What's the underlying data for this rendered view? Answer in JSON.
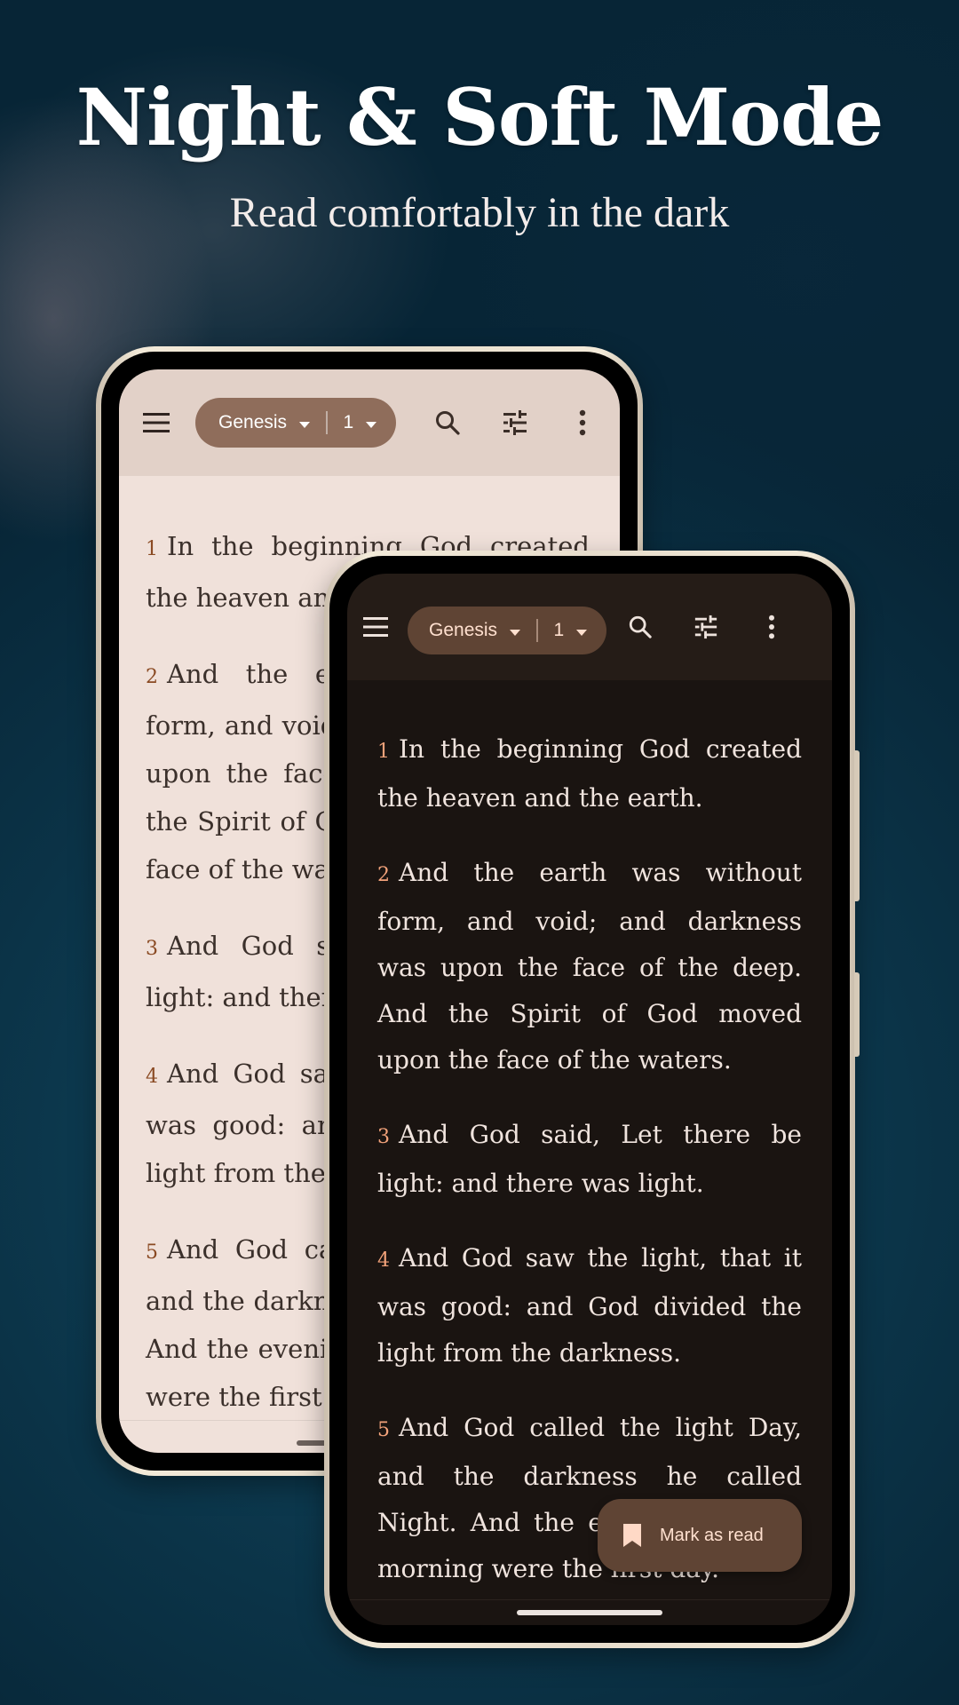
{
  "headline": "Night & Soft Mode",
  "subheadline": "Read comfortably in the dark",
  "colors": {
    "light_toolbar": "#e2d1c8",
    "light_page": "#f0e1da",
    "light_pill": "#8f6d5b",
    "light_verse_number": "#8a4a23",
    "dark_toolbar": "#251c17",
    "dark_page": "#1a1411",
    "dark_pill": "#5f4434",
    "dark_verse_number": "#f2a27a",
    "background": "#0b3a52"
  },
  "light_phone": {
    "theme": "soft",
    "toolbar": {
      "menu_icon": "hamburger-menu-icon",
      "book": "Genesis",
      "chapter": "1",
      "search_icon": "search-icon",
      "settings_icon": "tune-sliders-icon",
      "more_icon": "more-vertical-icon"
    },
    "verses": [
      {
        "num": "1",
        "text": "In the beginning God created the heaven and the earth."
      },
      {
        "num": "2",
        "text": "And the earth was without form, and void; and darkness was upon the face of the deep. And the Spirit of God moved upon the face of the waters."
      },
      {
        "num": "3",
        "text": "And God said, Let there be light: and there was light."
      },
      {
        "num": "4",
        "text": "And God saw the light, that it was good: and God divided the light from the darkness."
      },
      {
        "num": "5",
        "text": "And God called the light Day, and the darkness he called Night. And the evening and the morning were the first day."
      }
    ]
  },
  "dark_phone": {
    "theme": "night",
    "toolbar": {
      "menu_icon": "hamburger-menu-icon",
      "book": "Genesis",
      "chapter": "1",
      "search_icon": "search-icon",
      "settings_icon": "tune-sliders-icon",
      "more_icon": "more-vertical-icon"
    },
    "verses": [
      {
        "num": "1",
        "text": "In the beginning God created the heaven and the earth."
      },
      {
        "num": "2",
        "text": "And the earth was without form, and void; and darkness was upon the face of the deep. And the Spirit of God moved upon the face of the waters."
      },
      {
        "num": "3",
        "text": "And God said, Let there be light: and there was light."
      },
      {
        "num": "4",
        "text": "And God saw the light, that it was good: and God divided the light from the darkness."
      },
      {
        "num": "5",
        "text": "And God called the light Day, and the darkness he called Night. And the evening and the morning were the first day."
      }
    ],
    "fab": {
      "icon": "bookmark-icon",
      "label": "Mark as read"
    }
  }
}
